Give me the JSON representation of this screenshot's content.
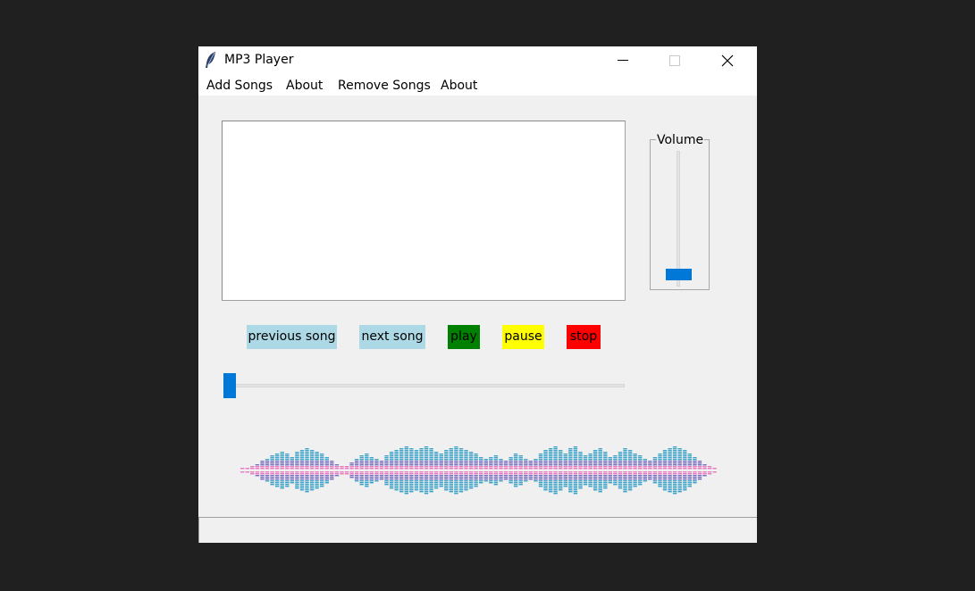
{
  "window": {
    "title": "MP3 Player",
    "app_icon": "feather-icon",
    "controls": [
      "minimize-icon",
      "maximize-icon",
      "close-icon"
    ]
  },
  "menu": {
    "items": [
      {
        "label": "Add Songs"
      },
      {
        "label": "About"
      },
      {
        "label": "Remove Songs"
      },
      {
        "label": "About"
      }
    ]
  },
  "playlist": {
    "items": []
  },
  "volume": {
    "label": "Volume",
    "level": 0.05
  },
  "controls": {
    "previous": {
      "label": "previous song",
      "color": "#add8e6"
    },
    "next": {
      "label": "next song",
      "color": "#add8e6"
    },
    "play": {
      "label": "play",
      "color": "#008000"
    },
    "pause": {
      "label": "pause",
      "color": "#ffff00"
    },
    "stop": {
      "label": "stop",
      "color": "#ff0000"
    }
  },
  "progress": {
    "position": 0.0
  },
  "waveform": {
    "icon": "equalizer-wave-image",
    "colors": [
      "#3fa3c9",
      "#e879c0",
      "#7b6fc1"
    ]
  },
  "status": {
    "text": ""
  }
}
